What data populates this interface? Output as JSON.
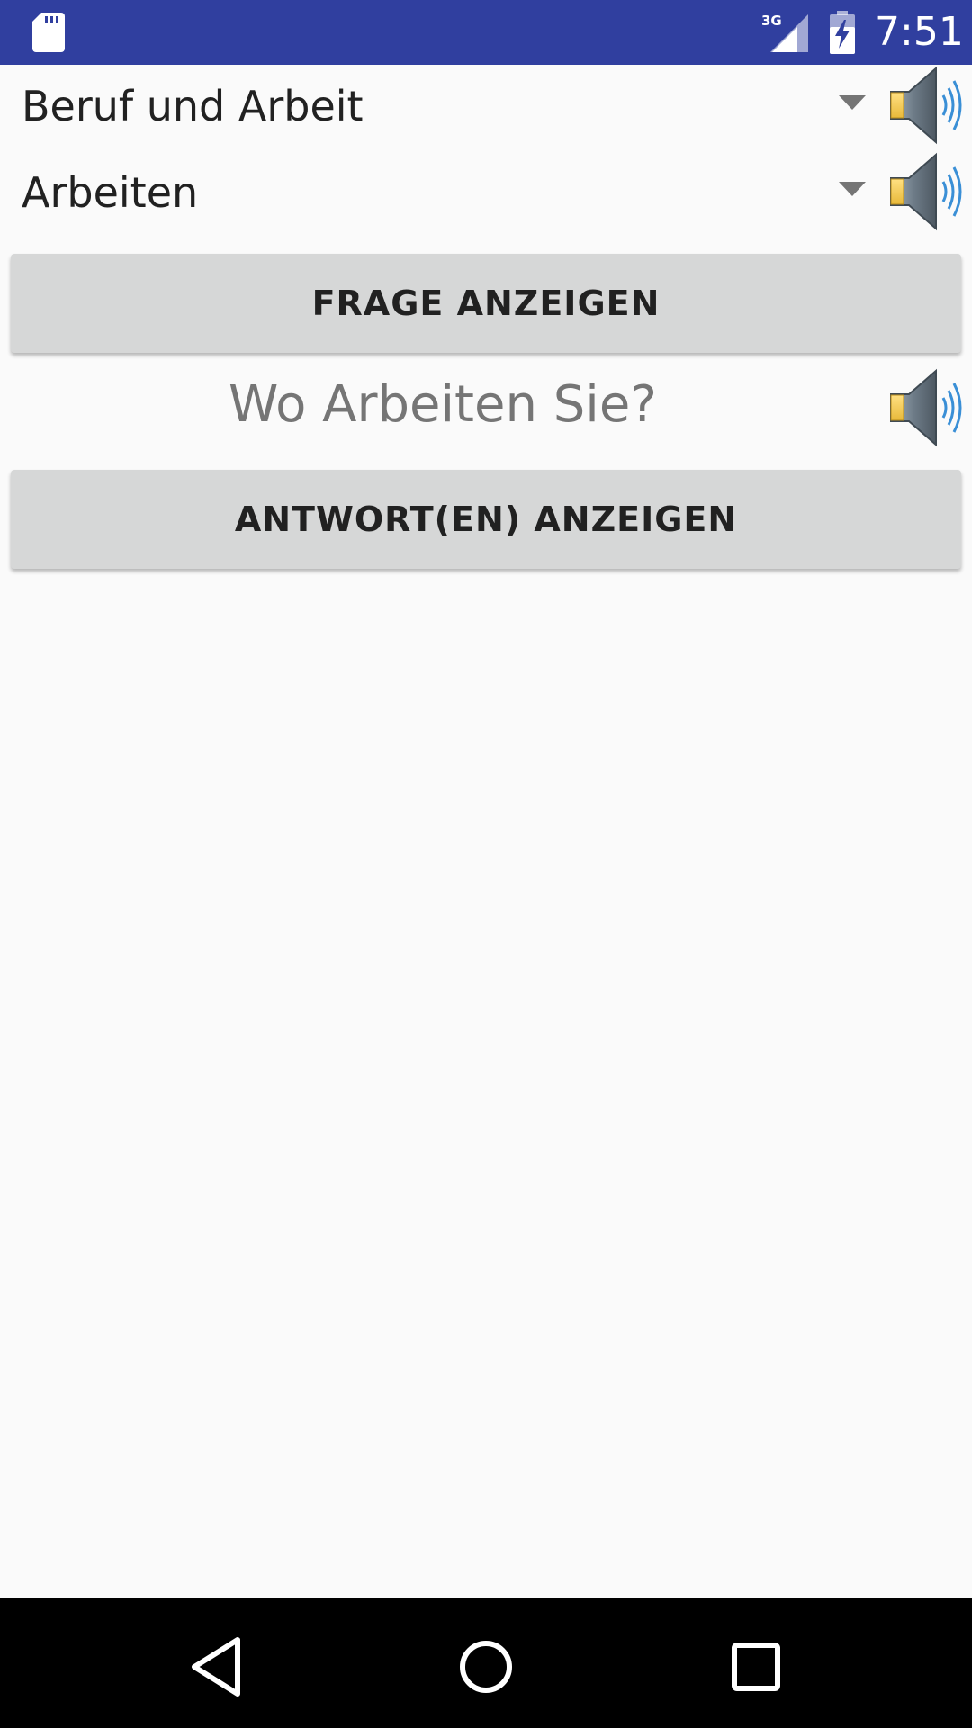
{
  "status_bar": {
    "time": "7:51",
    "network": "3G",
    "icons": [
      "sd-card-icon",
      "signal-icon",
      "battery-charging-icon"
    ],
    "background": "#303f9f"
  },
  "spinners": [
    {
      "selected": "Beruf und Arbeit",
      "icon": "speaker-icon"
    },
    {
      "selected": "Arbeiten",
      "icon": "speaker-icon"
    }
  ],
  "buttons": {
    "show_question": "FRAGE ANZEIGEN",
    "show_answers": "ANTWORT(EN) ANZEIGEN"
  },
  "question": {
    "text": "Wo Arbeiten Sie?",
    "icon": "speaker-icon"
  },
  "nav_bar": {
    "icons": [
      "back-icon",
      "home-icon",
      "recents-icon"
    ]
  },
  "colors": {
    "button_bg": "#d6d7d7",
    "page_bg": "#fafafa",
    "question_text": "#757575"
  }
}
